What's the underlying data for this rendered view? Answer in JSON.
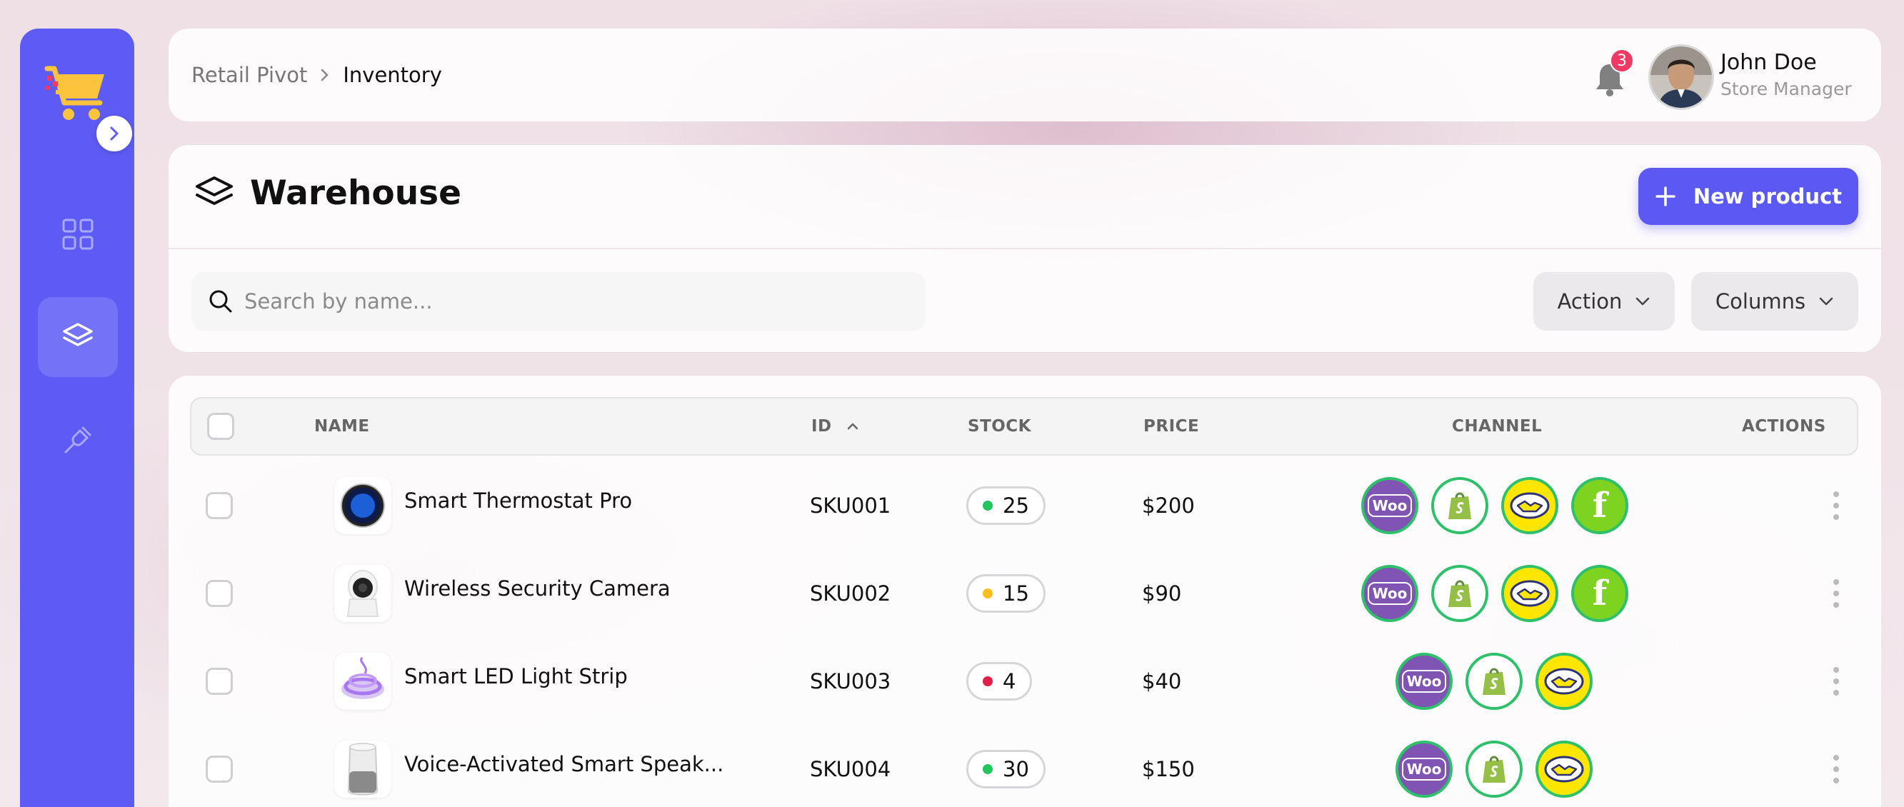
{
  "header": {
    "breadcrumb_root": "Retail Pivot",
    "breadcrumb_current": "Inventory",
    "notification_count": "3",
    "user_name": "John Doe",
    "user_role": "Store Manager"
  },
  "page": {
    "title": "Warehouse",
    "new_button_label": "New product",
    "search_placeholder": "Search by name...",
    "search_value": "",
    "action_label": "Action",
    "columns_label": "Columns"
  },
  "table": {
    "headers": {
      "name": "NAME",
      "id": "ID",
      "stock": "STOCK",
      "price": "PRICE",
      "channel": "CHANNEL",
      "actions": "ACTIONS"
    },
    "sort": {
      "column": "id",
      "direction": "ascending"
    },
    "rows": [
      {
        "name": "Smart Thermostat Pro",
        "id": "SKU001",
        "stock": "25",
        "stock_status_color": "#22c55e",
        "price": "$200",
        "channels": [
          "woocommerce",
          "shopify",
          "mercadolibre",
          "fruugo"
        ]
      },
      {
        "name": "Wireless Security Camera",
        "id": "SKU002",
        "stock": "15",
        "stock_status_color": "#fbbf24",
        "price": "$90",
        "channels": [
          "woocommerce",
          "shopify",
          "mercadolibre",
          "fruugo"
        ]
      },
      {
        "name": "Smart LED Light Strip",
        "id": "SKU003",
        "stock": "4",
        "stock_status_color": "#e11d48",
        "price": "$40",
        "channels": [
          "woocommerce",
          "shopify",
          "mercadolibre"
        ]
      },
      {
        "name": "Voice-Activated Smart Speak...",
        "id": "SKU004",
        "stock": "30",
        "stock_status_color": "#22c55e",
        "price": "$150",
        "channels": [
          "woocommerce",
          "shopify",
          "mercadolibre"
        ]
      }
    ]
  },
  "sidebar": {
    "items": [
      "dashboard-grid-icon",
      "layers-icon",
      "plug-icon"
    ],
    "active_item": "layers-icon"
  },
  "colors": {
    "accent": "#5e5bf5",
    "channel_ring": "#2ec06a",
    "woo": "#7f54b3",
    "shopify": "#95bf47",
    "mercadolibre": "#ffe600",
    "fruugo": "#7ed321"
  },
  "channel_icon_texts": {
    "woocommerce": "Woo",
    "fruugo": "f"
  }
}
